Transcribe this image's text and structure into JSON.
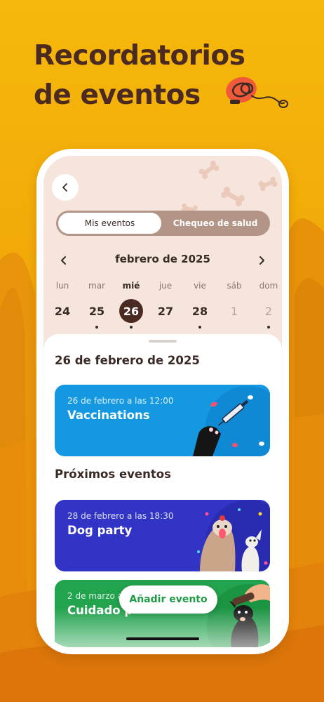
{
  "headline": {
    "line1": "Recordatorios",
    "line2": "de eventos"
  },
  "icons": {
    "back": "chevron-left-icon",
    "prev": "chevron-left-icon",
    "next": "chevron-right-icon",
    "leash": "leash-icon",
    "bone": "bone-icon"
  },
  "segmented": {
    "tab1": "Mis eventos",
    "tab2": "Chequeo de salud",
    "selected": "Mis eventos"
  },
  "calendar": {
    "month": "febrero de 2025",
    "days": [
      {
        "name": "lun",
        "num": "24",
        "dot": false,
        "selected": false,
        "dim": false
      },
      {
        "name": "mar",
        "num": "25",
        "dot": true,
        "selected": false,
        "dim": false
      },
      {
        "name": "mié",
        "num": "26",
        "dot": true,
        "selected": true,
        "dim": false
      },
      {
        "name": "jue",
        "num": "27",
        "dot": false,
        "selected": false,
        "dim": false
      },
      {
        "name": "vie",
        "num": "28",
        "dot": true,
        "selected": false,
        "dim": false
      },
      {
        "name": "sáb",
        "num": "1",
        "dot": false,
        "selected": false,
        "dim": true
      },
      {
        "name": "dom",
        "num": "2",
        "dot": true,
        "selected": false,
        "dim": true
      }
    ]
  },
  "selected_date_title": "26 de febrero de 2025",
  "events_today": [
    {
      "time": "26 de febrero a las 12:00",
      "title": "Vaccinations",
      "color": "#1498e2"
    }
  ],
  "upcoming_title": "Próximos eventos",
  "upcoming": [
    {
      "time": "28 de febrero a las 18:30",
      "title": "Dog party",
      "color": "#3134c4"
    },
    {
      "time": "2 de marzo a",
      "title": "Cuidado p",
      "color": "#22a34d"
    }
  ],
  "add_button": "Añadir evento",
  "colors": {
    "brand_orange": "#f4ae0a",
    "dark_brown": "#4a2a21",
    "sheet_bg": "#f6e5dc"
  }
}
